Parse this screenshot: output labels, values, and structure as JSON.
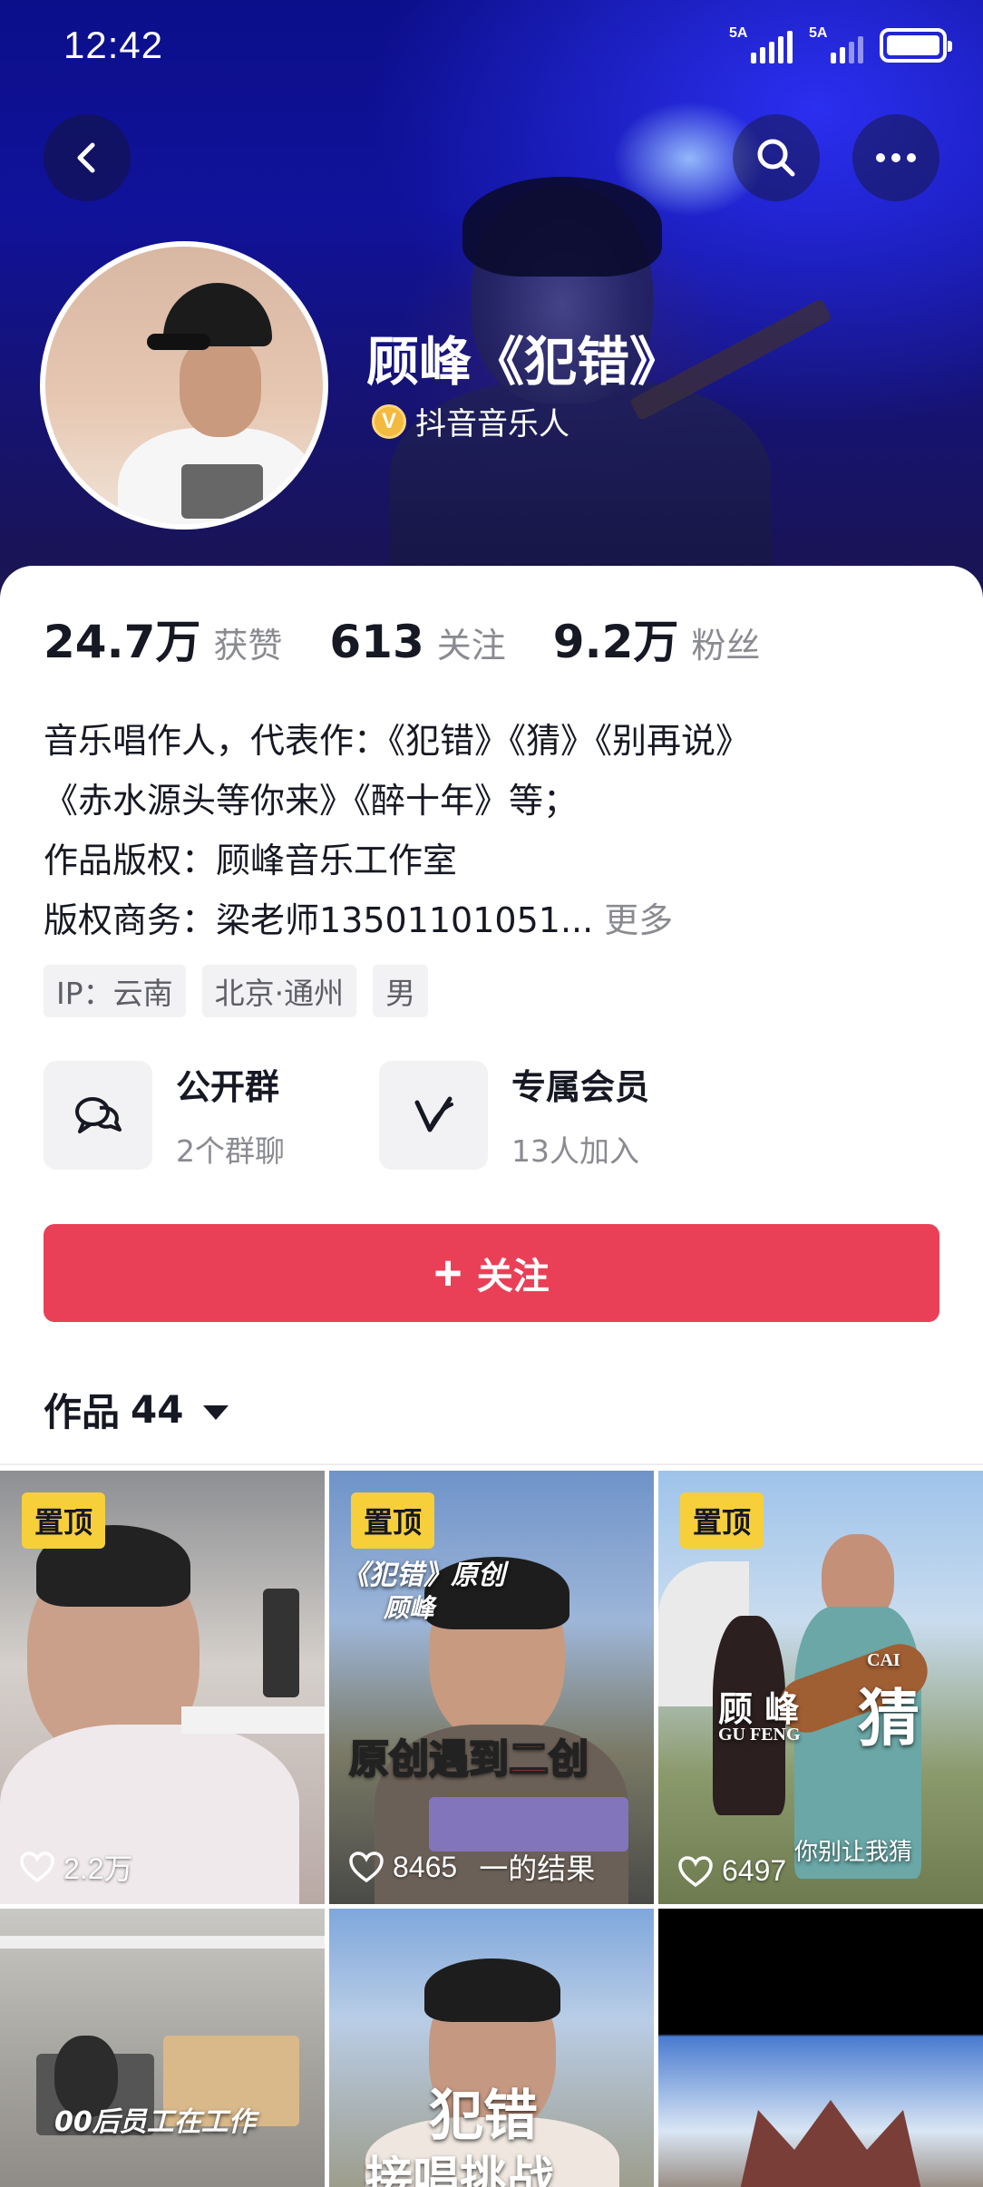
{
  "status_bar": {
    "time": "12:42",
    "signal1": "5A",
    "signal2": "5A"
  },
  "header": {
    "name": "顾峰《犯错》",
    "verified_label": "抖音音乐人",
    "verified_badge": "V"
  },
  "stats": [
    {
      "num": "24.7万",
      "label": "获赞"
    },
    {
      "num": "613",
      "label": "关注"
    },
    {
      "num": "9.2万",
      "label": "粉丝"
    }
  ],
  "bio": {
    "line1": "音乐唱作人，代表作：《犯错》《猜》《别再说》",
    "line2": "《赤水源头等你来》《醉十年》等；",
    "line3": "作品版权：顾峰音乐工作室",
    "line4": "版权商务：梁老师13501101051...",
    "more": "更多"
  },
  "tags": [
    "IP：云南",
    "北京·通州",
    "男"
  ],
  "features": [
    {
      "title": "公开群",
      "sub": "2个群聊"
    },
    {
      "title": "专属会员",
      "sub": "13人加入"
    }
  ],
  "follow_button": {
    "plus": "+",
    "label": "关注"
  },
  "works": {
    "label": "作品",
    "count": "44"
  },
  "videos": [
    {
      "pinned": "置顶",
      "likes": "2.2万"
    },
    {
      "pinned": "置顶",
      "likes": "8465",
      "title1": "《犯错》原创",
      "title2": "顾峰",
      "banner": "原创遇到二创",
      "caption": "一的结果"
    },
    {
      "pinned": "置顶",
      "likes": "6497",
      "name": "顾  峰",
      "name_en": "GU FENG",
      "song": "猜",
      "song_en": "CAI",
      "caption": "你别让我猜"
    },
    {
      "caption": "00后员工在工作"
    },
    {
      "title": "犯错",
      "subtitle": "接唱挑战"
    },
    {}
  ],
  "colors": {
    "accent": "#ea4057",
    "pin": "#f6cf3b",
    "verified": "#f4b93f"
  },
  "icons": [
    "back-icon",
    "search-icon",
    "more-icon",
    "group-chat-icon",
    "member-icon",
    "heart-icon",
    "caret-down-icon"
  ]
}
